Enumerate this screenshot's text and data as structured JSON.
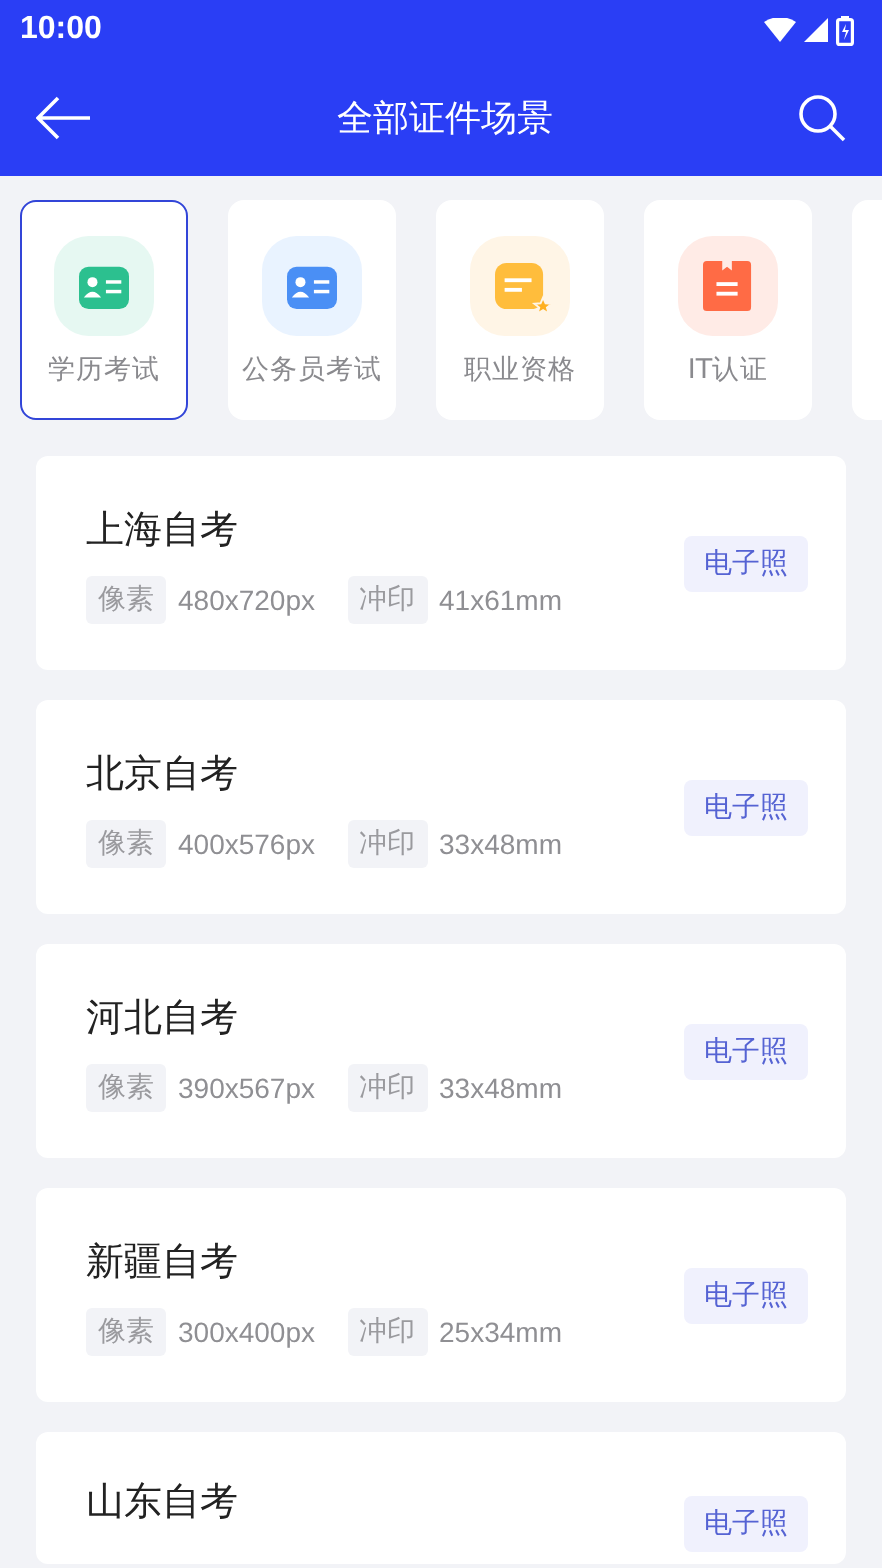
{
  "status_bar": {
    "time": "10:00"
  },
  "app_bar": {
    "title": "全部证件场景"
  },
  "categories": [
    {
      "label": "学历考试",
      "kind": "education",
      "selected": true
    },
    {
      "label": "公务员考试",
      "kind": "civil",
      "selected": false
    },
    {
      "label": "职业资格",
      "kind": "qualification",
      "selected": false
    },
    {
      "label": "IT认证",
      "kind": "it",
      "selected": false
    },
    {
      "kind": "unknown",
      "selected": false
    }
  ],
  "scenes": [
    {
      "name": "上海自考",
      "pixel_label": "像素",
      "pixel": "480x720px",
      "print_label": "冲印",
      "print": "41x61mm",
      "badge": "电子照"
    },
    {
      "name": "北京自考",
      "pixel_label": "像素",
      "pixel": "400x576px",
      "print_label": "冲印",
      "print": "33x48mm",
      "badge": "电子照"
    },
    {
      "name": "河北自考",
      "pixel_label": "像素",
      "pixel": "390x567px",
      "print_label": "冲印",
      "print": "33x48mm",
      "badge": "电子照"
    },
    {
      "name": "新疆自考",
      "pixel_label": "像素",
      "pixel": "300x400px",
      "print_label": "冲印",
      "print": "25x34mm",
      "badge": "电子照"
    },
    {
      "name": "山东自考",
      "badge": "电子照"
    }
  ]
}
